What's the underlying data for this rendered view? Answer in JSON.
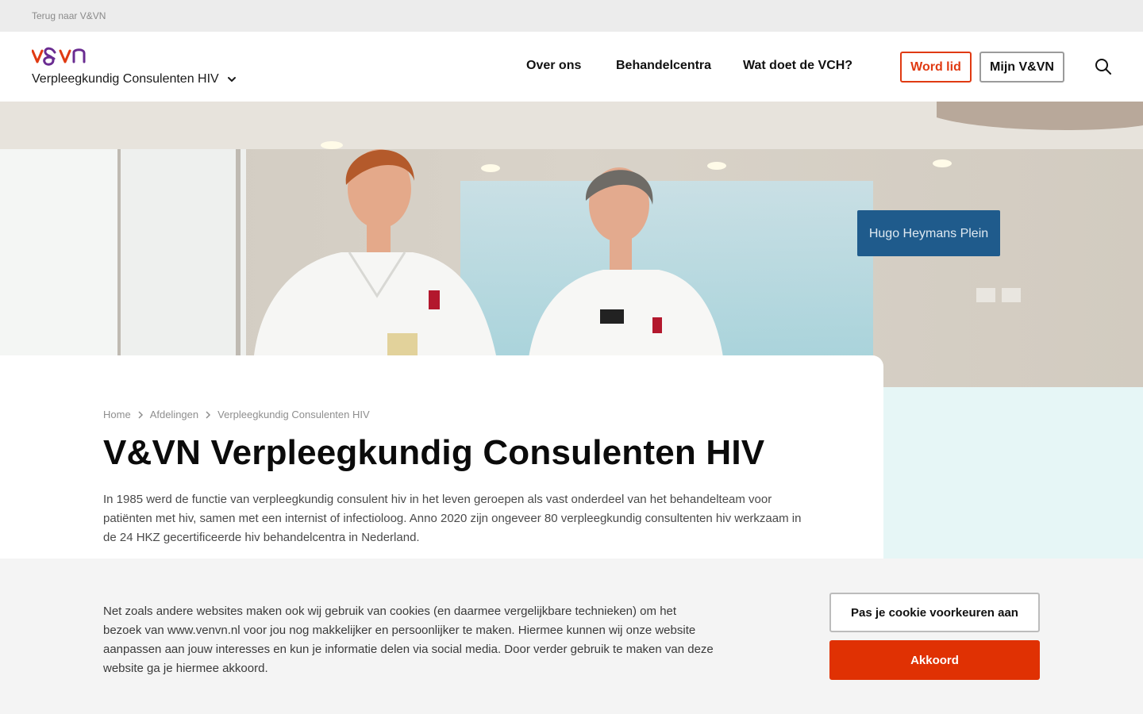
{
  "topbar": {
    "back_link": "Terug naar V&VN"
  },
  "header": {
    "site_name": "Verpleegkundig Consulenten HIV",
    "nav": [
      "Over ons",
      "Behandelcentra",
      "Wat doet de VCH?"
    ],
    "join_label": "Word lid",
    "account_label": "Mijn V&VN",
    "search_icon": "search-icon"
  },
  "hero": {
    "sign_text": "Hugo Heymans Plein"
  },
  "content": {
    "breadcrumb": [
      "Home",
      "Afdelingen",
      "Verpleegkundig Consulenten HIV"
    ],
    "title": "V&VN Verpleegkundig Consulenten HIV",
    "intro": "In 1985 werd de functie van verpleegkundig consulent hiv in het leven geroepen als vast onderdeel van het behandelteam voor patiënten met hiv, samen met een internist of infectioloog. Anno 2020 zijn ongeveer 80 verpleegkundig consultenten hiv werkzaam in de 24 HKZ gecertificeerde hiv behandelcentra in Nederland."
  },
  "cookie": {
    "text": "Net zoals andere websites maken ook wij gebruik van cookies (en daarmee vergelijkbare technieken) om het bezoek van www.venvn.nl voor jou nog makkelijker en persoonlijker te maken. Hiermee kunnen wij onze website aanpassen aan jouw interesses en kun je informatie delen via social media. Door verder gebruik te maken van deze website ga je hiermee akkoord.",
    "preferences_label": "Pas je cookie voorkeuren aan",
    "accept_label": "Akkoord"
  },
  "colors": {
    "accent": "#e03a12",
    "accept_button": "#e03103",
    "teal_panel": "#e6f6f6",
    "logo_purple": "#6a2c91"
  }
}
